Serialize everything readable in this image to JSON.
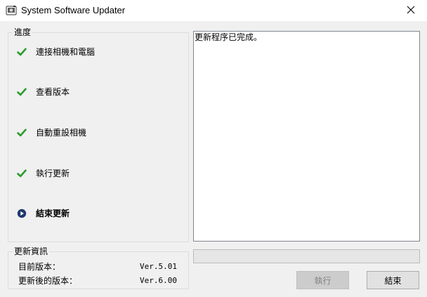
{
  "window": {
    "title": "System Software Updater"
  },
  "progress": {
    "legend": "進度",
    "steps": [
      {
        "label": "連接相機和電腦",
        "status": "done"
      },
      {
        "label": "查看版本",
        "status": "done"
      },
      {
        "label": "自動重設相機",
        "status": "done"
      },
      {
        "label": "執行更新",
        "status": "done"
      },
      {
        "label": "結束更新",
        "status": "current"
      }
    ]
  },
  "update_info": {
    "legend": "更新資訊",
    "current_label": "目前版本：",
    "current_value": "Ver.5.01",
    "new_label": "更新後的版本：",
    "new_value": "Ver.6.00"
  },
  "log": {
    "text": "更新程序已完成。"
  },
  "progress_bar": {
    "fraction": 0
  },
  "buttons": {
    "execute": "執行",
    "finish": "結束"
  },
  "colors": {
    "check_green": "#2a9d2a",
    "current_blue": "#1f3a6e"
  },
  "icons": {
    "done": "check-icon",
    "current": "play-circle-icon",
    "close": "close-icon",
    "app": "app-icon"
  }
}
